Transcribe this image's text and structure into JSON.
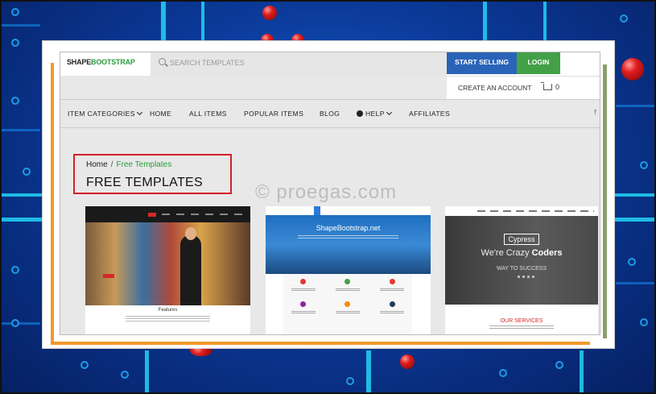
{
  "logo": {
    "part1": "SHAPE",
    "part2": "BOOTSTRAP"
  },
  "search": {
    "placeholder": "SEARCH TEMPLATES"
  },
  "header": {
    "start_selling": "START SELLING",
    "login": "LOGIN",
    "create_account": "CREATE AN ACCOUNT",
    "cart_count": "0"
  },
  "nav": {
    "item_categories": "ITEM CATEGORIES",
    "home": "HOME",
    "all_items": "ALL ITEMS",
    "popular_items": "POPULAR ITEMS",
    "blog": "BLOG",
    "help": "HELP",
    "affiliates": "AFFILIATES",
    "facebook": "f"
  },
  "breadcrumb": {
    "home": "Home",
    "separator": "/",
    "current": "Free Templates"
  },
  "page_title": "FREE TEMPLATES",
  "watermark": "© proegas.com",
  "thumbs": {
    "t1": {
      "feature_title": "Features"
    },
    "t2": {
      "title": "ShapeBootstrap.net"
    },
    "t3": {
      "brand": "Cypress",
      "tag_prefix": "We're Crazy",
      "tag_bold": "Coders",
      "way": "WAY TO SUCCESS",
      "services": "OUR SERVICES"
    }
  },
  "colors": {
    "accent_green": "#43a047",
    "accent_blue": "#2a64b8",
    "highlight_red": "#d3202a"
  }
}
